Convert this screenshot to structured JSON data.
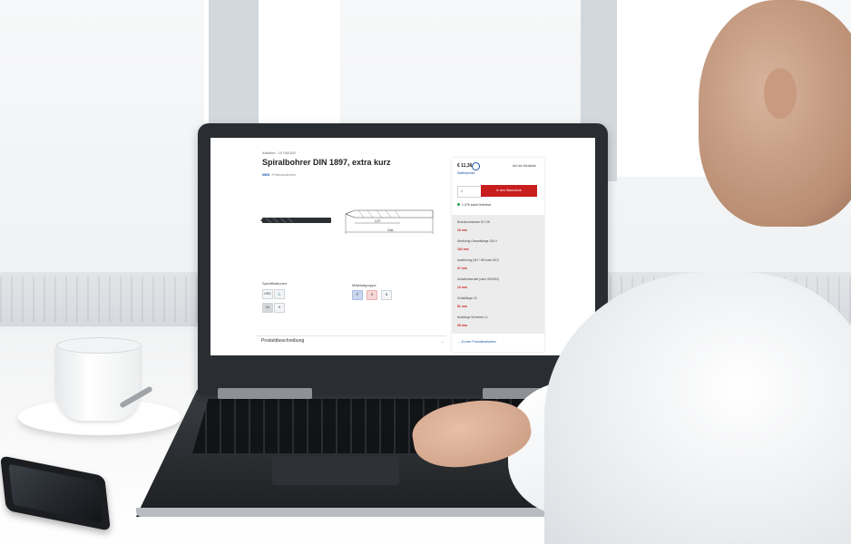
{
  "product": {
    "article_number": "Artikelnr.: 10 000100",
    "title": "Spiralbohrer DIN 1897, extra kurz",
    "brand": "NWS",
    "brand_sub": "/ Präzisionsbohrer"
  },
  "diagram": {
    "lcf": "LCF",
    "oal": "OAL"
  },
  "selection": {
    "spec_label": "Spezifikationen",
    "spec_chips": [
      "HSS",
      "⚓",
      "Ni",
      "K"
    ],
    "material_label": "Materialgruppe",
    "material_chips": [
      "P",
      "K",
      "N"
    ]
  },
  "description": {
    "label": "Produktbeschreibung",
    "chevron": "⌄"
  },
  "buy": {
    "price": "€ 11,36",
    "watchlist": "Auf die Merkliste",
    "staffel": "Staffelpreise",
    "quantity": "1",
    "cart_button": "In den Warenkorb",
    "stock": "1.076 sofort lieferbar"
  },
  "specs": [
    {
      "key": "Bohrdurchmesser DC H8",
      "value": "10 mm"
    },
    {
      "key": "Werkzeug-Gesamtlänge OAL h",
      "value": "102 mm"
    },
    {
      "key": "Ausführung (W1 / W2 nach ISO)",
      "value": "37 mm"
    },
    {
      "key": "Aufnahmeschaft (nach ISO/DIN)",
      "value": "13 mm"
    },
    {
      "key": "Schaftlänge LS",
      "value": "51 mm"
    },
    {
      "key": "Nutzlänge Schneide LU",
      "value": "39 mm"
    }
  ],
  "variants_link": "Zu den Produktvarianten",
  "colors": {
    "brand_blue": "#1a56a8",
    "accent_red": "#c81e1e",
    "stock_green": "#2ba44b"
  }
}
